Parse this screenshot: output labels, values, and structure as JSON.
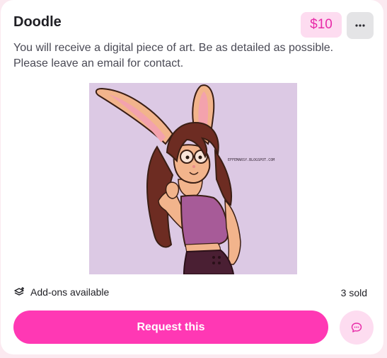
{
  "listing": {
    "title": "Doodle",
    "price": "$10",
    "description": "You will receive a digital piece of art. Be as detailed as possible. Please leave an email for contact.",
    "image": {
      "signature": "EFFEMARSY.BLOGSPOT.COM"
    },
    "addons_label": "Add-ons available",
    "sold_label": "3 sold",
    "request_label": "Request this"
  },
  "icons": {
    "more": "more-horizontal-icon",
    "addons": "layers-plus-icon",
    "chat": "chat-bubble-icon"
  },
  "colors": {
    "accent": "#ff38b4",
    "price_bg": "#fddcf0",
    "price_text": "#e82ba8",
    "page_bg": "#fbe9f0"
  }
}
